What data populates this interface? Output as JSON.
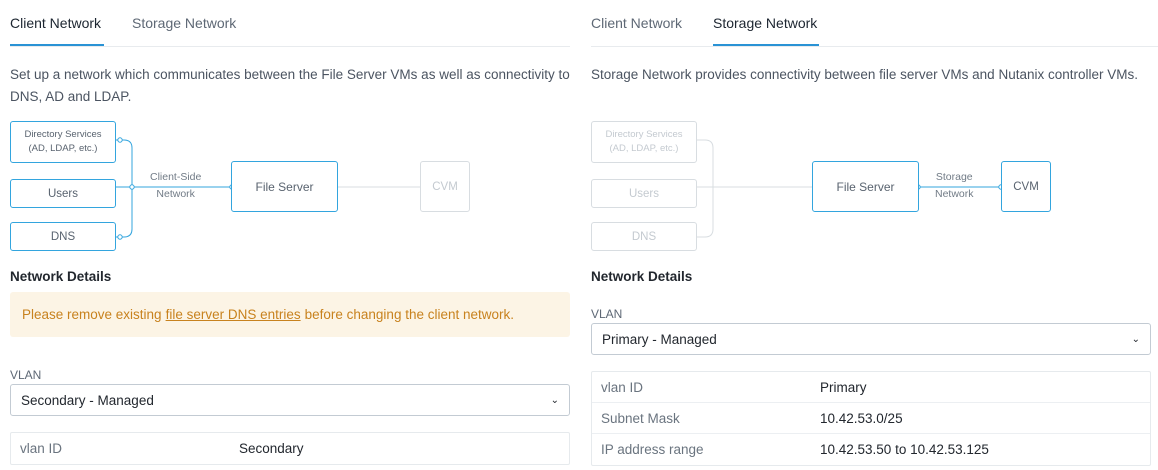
{
  "left": {
    "tabs": [
      {
        "label": "Client Network",
        "active": true
      },
      {
        "label": "Storage Network",
        "active": false
      }
    ],
    "description": "Set up a network which communicates between the File Server VMs as well as connectivity to DNS, AD and LDAP.",
    "diagram": {
      "directory_line1": "Directory Services",
      "directory_line2": "(AD, LDAP, etc.)",
      "users": "Users",
      "dns": "DNS",
      "network_line1": "Client-Side",
      "network_line2": "Network",
      "file_server": "File Server",
      "cvm": "CVM"
    },
    "section_title": "Network Details",
    "warning": {
      "prefix": "Please remove existing",
      "link": "file server DNS entries",
      "suffix": "before changing the client network."
    },
    "vlan_label": "VLAN",
    "vlan_selected": "Secondary - Managed",
    "details": [
      {
        "key": "vlan ID",
        "value": "Secondary"
      }
    ]
  },
  "right": {
    "tabs": [
      {
        "label": "Client Network",
        "active": false
      },
      {
        "label": "Storage Network",
        "active": true
      }
    ],
    "description": "Storage Network provides connectivity between file server VMs and Nutanix controller VMs.",
    "diagram": {
      "directory_line1": "Directory Services",
      "directory_line2": "(AD, LDAP, etc.)",
      "users": "Users",
      "dns": "DNS",
      "network_line1": "Storage",
      "network_line2": "Network",
      "file_server": "File Server",
      "cvm": "CVM"
    },
    "section_title": "Network Details",
    "vlan_label": "VLAN",
    "vlan_selected": "Primary - Managed",
    "details": [
      {
        "key": "vlan ID",
        "value": "Primary"
      },
      {
        "key": "Subnet Mask",
        "value": "10.42.53.0/25"
      },
      {
        "key": "IP address range",
        "value": "10.42.53.50 to 10.42.53.125"
      }
    ]
  },
  "colors": {
    "accent": "#2a93d5",
    "diagram_line": "#33a5de",
    "warning_bg": "#fcf4e5",
    "warning_text": "#c8821e"
  },
  "icons": {
    "select_chevron": "chevron-down-icon"
  }
}
